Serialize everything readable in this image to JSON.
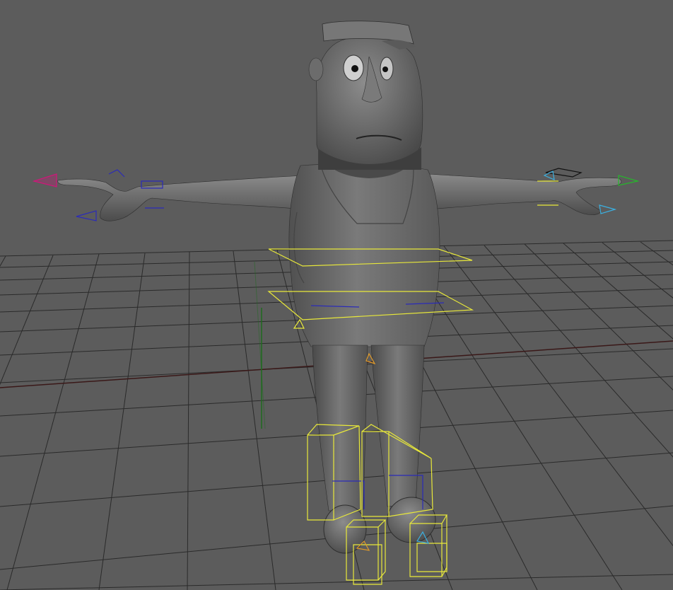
{
  "viewport": {
    "background": "#5c5c5c",
    "grid_color": "#1e1e1e",
    "axis_x_color": "#5b1515",
    "axis_z_color": "#1f6b1f"
  },
  "character": {
    "body_color": "#6e6e6e",
    "shadow_color": "#3c3c3c",
    "highlight_color": "#8a8a8a"
  },
  "rig": {
    "control_color": "#e8e83a",
    "joint_color": "#2b2bb8",
    "left_tip_color": "#d0167a",
    "left_thumb_color": "#2b2bb8",
    "right_tip_color": "#25b82a",
    "right_thumb_color": "#3bb0e0"
  }
}
